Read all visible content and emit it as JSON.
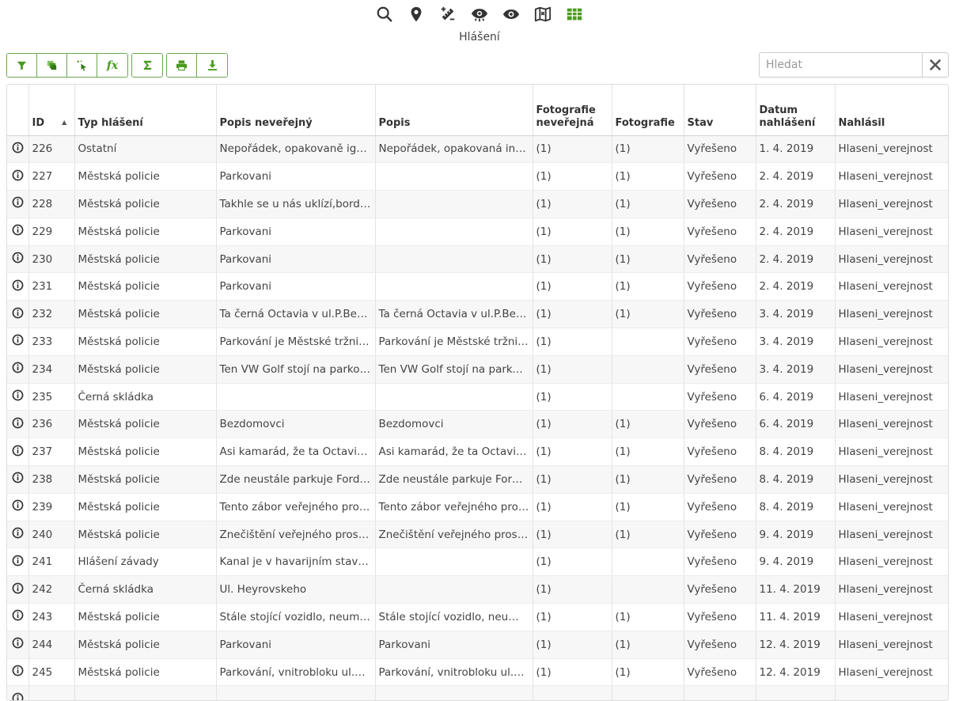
{
  "top_icons": [
    "search-icon",
    "map-marker-icon",
    "measure-icon",
    "eye-settings-icon",
    "eye-icon",
    "map-icon",
    "table-icon"
  ],
  "title": "Hlášení",
  "toolbar": {
    "groups": [
      [
        "filter-icon",
        "layers-icon",
        "select-icon",
        "fx-icon"
      ],
      [
        "sigma-icon"
      ],
      [
        "print-icon",
        "download-icon"
      ]
    ],
    "fx_label": "fx"
  },
  "search": {
    "placeholder": "Hledat",
    "value": ""
  },
  "columns": [
    "",
    "ID",
    "Typ hlášení",
    "Popis neveřejný",
    "Popis",
    "Fotografie neveřejná",
    "Fotografie",
    "Stav",
    "Datum nahlášení",
    "Nahlásil"
  ],
  "sort": {
    "column": "ID",
    "direction": "asc"
  },
  "rows": [
    [
      "226",
      "Ostatní",
      "Nepořádek, opakovaně ignorovaný",
      "Nepořádek, opakovaná informace",
      "(1)",
      "(1)",
      "Vyřešeno",
      "1. 4. 2019",
      "Hlaseni_verejnost"
    ],
    [
      "227",
      "Městská policie",
      "Parkovani",
      "",
      "(1)",
      "(1)",
      "Vyřešeno",
      "2. 4. 2019",
      "Hlaseni_verejnost"
    ],
    [
      "228",
      "Městská policie",
      "Takhle se u nás uklízí,bordel všude",
      "",
      "(1)",
      "(1)",
      "Vyřešeno",
      "2. 4. 2019",
      "Hlaseni_verejnost"
    ],
    [
      "229",
      "Městská policie",
      "Parkovani",
      "",
      "(1)",
      "(1)",
      "Vyřešeno",
      "2. 4. 2019",
      "Hlaseni_verejnost"
    ],
    [
      "230",
      "Městská policie",
      "Parkovani",
      "",
      "(1)",
      "(1)",
      "Vyřešeno",
      "2. 4. 2019",
      "Hlaseni_verejnost"
    ],
    [
      "231",
      "Městská policie",
      "Parkovani",
      "",
      "(1)",
      "(1)",
      "Vyřešeno",
      "2. 4. 2019",
      "Hlaseni_verejnost"
    ],
    [
      "232",
      "Městská policie",
      "Ta černá Octavia v ul.P.Bezruče",
      "Ta černá Octavia v ul.P.Bezruče",
      "(1)",
      "(1)",
      "Vyřešeno",
      "3. 4. 2019",
      "Hlaseni_verejnost"
    ],
    [
      "233",
      "Městská policie",
      "Parkování je Městské tržnice zakázáno",
      "Parkování je Městské tržnice zakázáno",
      "(1)",
      "",
      "Vyřešeno",
      "3. 4. 2019",
      "Hlaseni_verejnost"
    ],
    [
      "234",
      "Městská policie",
      "Ten VW Golf stojí na parkovišti",
      "Ten VW Golf stojí na parkovišti",
      "(1)",
      "",
      "Vyřešeno",
      "3. 4. 2019",
      "Hlaseni_verejnost"
    ],
    [
      "235",
      "Černá skládka",
      "",
      "",
      "(1)",
      "",
      "Vyřešeno",
      "6. 4. 2019",
      "Hlaseni_verejnost"
    ],
    [
      "236",
      "Městská policie",
      "Bezdomovci",
      "Bezdomovci",
      "(1)",
      "(1)",
      "Vyřešeno",
      "6. 4. 2019",
      "Hlaseni_verejnost"
    ],
    [
      "237",
      "Městská policie",
      "Asi kamarád, že ta Octavia stojí",
      "Asi kamarád, že ta Octavia stojí",
      "(1)",
      "(1)",
      "Vyřešeno",
      "8. 4. 2019",
      "Hlaseni_verejnost"
    ],
    [
      "238",
      "Městská policie",
      "Zde neustále parkuje Ford, který",
      "Zde neustále parkuje Ford, který",
      "(1)",
      "(1)",
      "Vyřešeno",
      "8. 4. 2019",
      "Hlaseni_verejnost"
    ],
    [
      "239",
      "Městská policie",
      "Tento zábor veřejného prostranství",
      "Tento zábor veřejného prostranství",
      "(1)",
      "(1)",
      "Vyřešeno",
      "8. 4. 2019",
      "Hlaseni_verejnost"
    ],
    [
      "240",
      "Městská policie",
      "Znečištění veřejného prostranství",
      "Znečištění veřejného prostranství",
      "(1)",
      "(1)",
      "Vyřešeno",
      "9. 4. 2019",
      "Hlaseni_verejnost"
    ],
    [
      "241",
      "Hlášení závady",
      "Kanal je v havarijním stavu, hrozí",
      "",
      "(1)",
      "",
      "Vyřešeno",
      "9. 4. 2019",
      "Hlaseni_verejnost"
    ],
    [
      "242",
      "Černá skládka",
      "Ul. Heyrovskeho",
      "",
      "(1)",
      "",
      "Vyřešeno",
      "11. 4. 2019",
      "Hlaseni_verejnost"
    ],
    [
      "243",
      "Městská policie",
      "Stále stojící vozidlo, neumíte s tím",
      "Stále stojící vozidlo, neumíte s tím",
      "(1)",
      "(1)",
      "Vyřešeno",
      "11. 4. 2019",
      "Hlaseni_verejnost"
    ],
    [
      "244",
      "Městská policie",
      "Parkovani",
      "Parkovani",
      "(1)",
      "(1)",
      "Vyřešeno",
      "12. 4. 2019",
      "Hlaseni_verejnost"
    ],
    [
      "245",
      "Městská policie",
      "Parkování, vnitrobloku ul.Wolkerova",
      "Parkování, vnitrobloku ul.Wolkerova",
      "(1)",
      "(1)",
      "Vyřešeno",
      "12. 4. 2019",
      "Hlaseni_verejnost"
    ],
    [
      "",
      "",
      "",
      "",
      "",
      "",
      "",
      "",
      ""
    ]
  ],
  "colors": {
    "accent": "#4a9a1e",
    "border": "#6aa84f",
    "icon_dark": "#333333"
  }
}
